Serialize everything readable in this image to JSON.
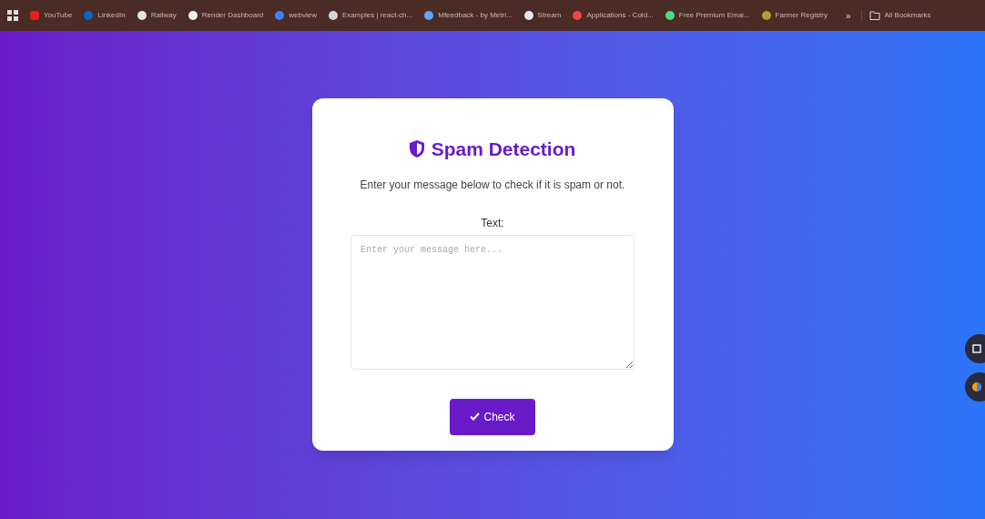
{
  "bookmarks": [
    {
      "label": "YouTube",
      "kind": "youtube"
    },
    {
      "label": "LinkedIn",
      "kind": "linkedin"
    },
    {
      "label": "Railway",
      "kind": "railway"
    },
    {
      "label": "Render Dashboard",
      "kind": "render"
    },
    {
      "label": "webview",
      "kind": "person"
    },
    {
      "label": "Examples | react-ch...",
      "kind": "stack"
    },
    {
      "label": "Mfeedback - by Metri...",
      "kind": "metric"
    },
    {
      "label": "Stream",
      "kind": "stream"
    },
    {
      "label": "Applications - Cold...",
      "kind": "app"
    },
    {
      "label": "Free Premium Emai...",
      "kind": "mail"
    },
    {
      "label": "Farmer Registry",
      "kind": "farmer"
    }
  ],
  "more": "»",
  "all_bookmarks": "All Bookmarks",
  "card": {
    "title": "Spam Detection",
    "subtitle": "Enter your message below to check if it is spam or not.",
    "field_label": "Text:",
    "placeholder": "Enter your message here...",
    "button": "Check"
  }
}
